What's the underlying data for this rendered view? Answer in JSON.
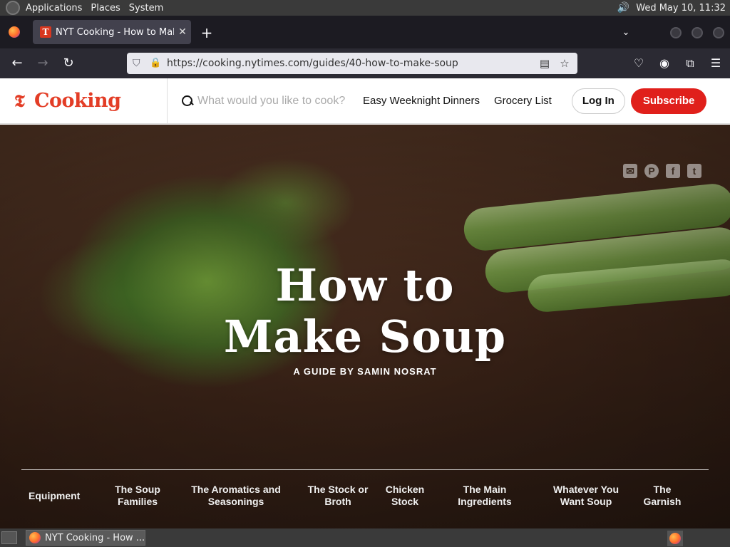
{
  "topbar": {
    "menus": [
      "Applications",
      "Places",
      "System"
    ],
    "clock": "Wed May 10, 11:32"
  },
  "browser": {
    "tab_title": "NYT Cooking - How to Make",
    "url": "https://cooking.nytimes.com/guides/40-how-to-make-soup"
  },
  "site": {
    "wordmark": "Cooking",
    "search_placeholder": "What would you like to cook?",
    "nav_links": [
      "Easy Weeknight Dinners",
      "Grocery List"
    ],
    "login_label": "Log In",
    "subscribe_label": "Subscribe",
    "subscribe_color": "#e0201b",
    "brand_color": "#e33d26"
  },
  "hero": {
    "title_line1": "How to",
    "title_line2": "Make Soup",
    "subtitle": "A GUIDE BY SAMIN NOSRAT",
    "share_icons": [
      "email-icon",
      "pinterest-icon",
      "facebook-icon",
      "twitter-icon"
    ],
    "chapters": [
      "Equipment",
      "The Soup Families",
      "The Aromatics and Seasonings",
      "The Stock or Broth",
      "Chicken Stock",
      "The Main Ingredients",
      "Whatever You Want Soup",
      "The Garnish"
    ]
  },
  "taskbar": {
    "task_label": "NYT Cooking - How ..."
  }
}
